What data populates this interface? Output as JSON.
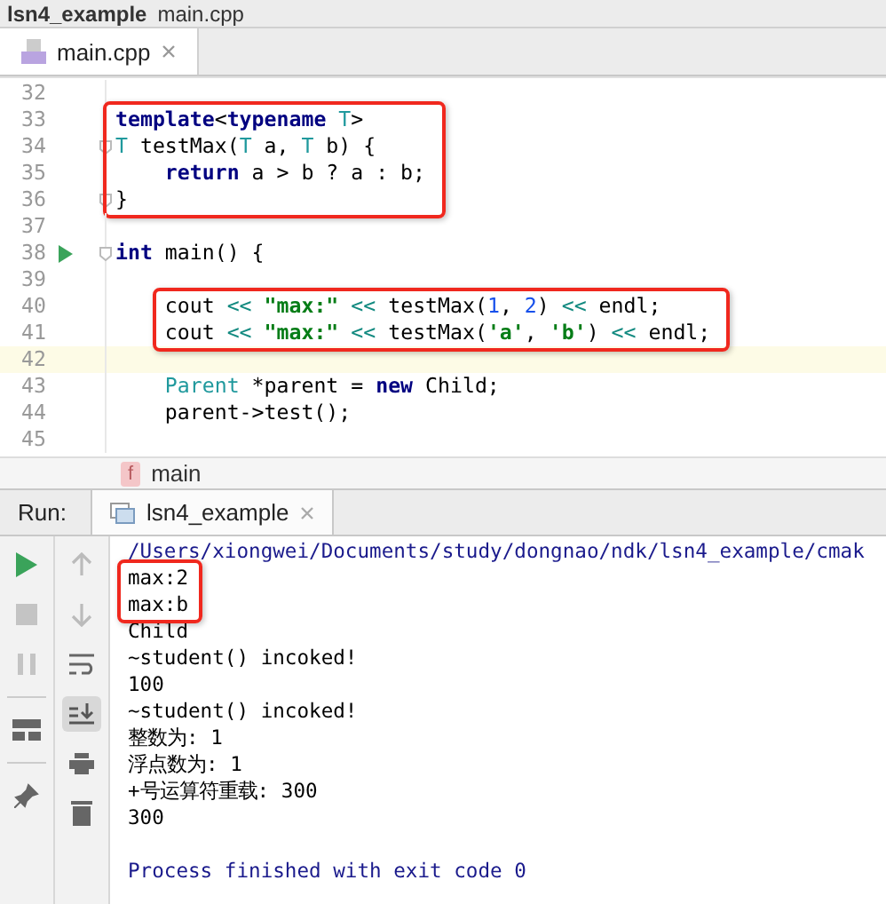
{
  "breadcrumb": [
    "lsn4_example",
    "main.cpp"
  ],
  "editor_tabs": [
    {
      "label": "main.cpp",
      "selected": true
    }
  ],
  "code": [
    {
      "lines": [
        {
          "number": "32"
        }
      ]
    },
    {
      "boxed": true,
      "lines": [
        {
          "number": "33",
          "tokens": [
            {
              "kind": "kw",
              "text": "template"
            },
            {
              "kind": "plain",
              "text": "<"
            },
            {
              "kind": "kw",
              "text": "typename"
            },
            {
              "kind": "type",
              "text": " T"
            },
            {
              "kind": "plain",
              "text": ">"
            }
          ]
        },
        {
          "number": "34",
          "fold": true,
          "tokens": [
            {
              "kind": "type",
              "text": "T"
            },
            {
              "kind": "plain",
              "text": " testMax("
            },
            {
              "kind": "type",
              "text": "T"
            },
            {
              "kind": "plain",
              "text": " a, "
            },
            {
              "kind": "type",
              "text": "T"
            },
            {
              "kind": "plain",
              "text": " b) {"
            }
          ]
        },
        {
          "number": "35",
          "tokens": [
            {
              "kind": "kw",
              "text": "    return"
            },
            {
              "kind": "plain",
              "text": " a > b ? a : b;"
            }
          ]
        },
        {
          "number": "36",
          "fold": true,
          "tokens": [
            {
              "kind": "plain",
              "text": "}"
            }
          ]
        }
      ]
    },
    {
      "lines": [
        {
          "number": "37"
        },
        {
          "number": "38",
          "run": true,
          "fold": true,
          "tokens": [
            {
              "kind": "kw",
              "text": "int"
            },
            {
              "kind": "plain",
              "text": " main() {"
            }
          ]
        },
        {
          "number": "39"
        }
      ]
    },
    {
      "boxed": true,
      "lines": [
        {
          "number": "40",
          "tokens": [
            {
              "kind": "plain",
              "text": "    cout "
            },
            {
              "kind": "op",
              "text": "<<"
            },
            {
              "kind": "str",
              "text": " \"max:\""
            },
            {
              "kind": "op",
              "text": " <<"
            },
            {
              "kind": "plain",
              "text": " testMax("
            },
            {
              "kind": "num",
              "text": "1"
            },
            {
              "kind": "plain",
              "text": ", "
            },
            {
              "kind": "num",
              "text": "2"
            },
            {
              "kind": "plain",
              "text": ") "
            },
            {
              "kind": "op",
              "text": "<<"
            },
            {
              "kind": "plain",
              "text": " endl;"
            }
          ]
        },
        {
          "number": "41",
          "tokens": [
            {
              "kind": "plain",
              "text": "    cout "
            },
            {
              "kind": "op",
              "text": "<<"
            },
            {
              "kind": "str",
              "text": " \"max:\""
            },
            {
              "kind": "op",
              "text": " <<"
            },
            {
              "kind": "plain",
              "text": " testMax("
            },
            {
              "kind": "str",
              "text": "'a'"
            },
            {
              "kind": "plain",
              "text": ", "
            },
            {
              "kind": "str",
              "text": "'b'"
            },
            {
              "kind": "plain",
              "text": ") "
            },
            {
              "kind": "op",
              "text": "<<"
            },
            {
              "kind": "plain",
              "text": " endl;"
            }
          ]
        }
      ]
    },
    {
      "lines": [
        {
          "number": "42",
          "current": true
        },
        {
          "number": "43",
          "tokens": [
            {
              "kind": "type",
              "text": "    Parent"
            },
            {
              "kind": "plain",
              "text": " *parent = "
            },
            {
              "kind": "kw",
              "text": "new"
            },
            {
              "kind": "plain",
              "text": " Child;"
            }
          ]
        },
        {
          "number": "44",
          "tokens": [
            {
              "kind": "plain",
              "text": "    parent->test();"
            }
          ]
        },
        {
          "number": "45"
        }
      ]
    }
  ],
  "function_crumb": {
    "badge": "f",
    "name": "main"
  },
  "run_panel": {
    "label": "Run:",
    "tabs": [
      {
        "label": "lsn4_example",
        "selected": true
      }
    ]
  },
  "console": [
    {
      "lines": [
        {
          "kind": "path",
          "text": "/Users/xiongwei/Documents/study/dongnao/ndk/lsn4_example/cmak"
        }
      ]
    },
    {
      "boxed": true,
      "lines": [
        {
          "kind": "output",
          "text": "max:2"
        },
        {
          "kind": "output",
          "text": "max:b"
        }
      ]
    },
    {
      "lines": [
        {
          "kind": "output",
          "text": "Child"
        },
        {
          "kind": "output",
          "text": "~student() incoked!"
        },
        {
          "kind": "output",
          "text": "100"
        },
        {
          "kind": "output",
          "text": "~student() incoked!"
        },
        {
          "kind": "output",
          "text": "整数为: 1"
        },
        {
          "kind": "output",
          "text": "浮点数为: 1"
        },
        {
          "kind": "output",
          "text": "+号运算符重载: 300"
        },
        {
          "kind": "output",
          "text": "300"
        },
        {
          "kind": "blank"
        },
        {
          "kind": "path",
          "text": "Process finished with exit code 0"
        }
      ]
    }
  ]
}
